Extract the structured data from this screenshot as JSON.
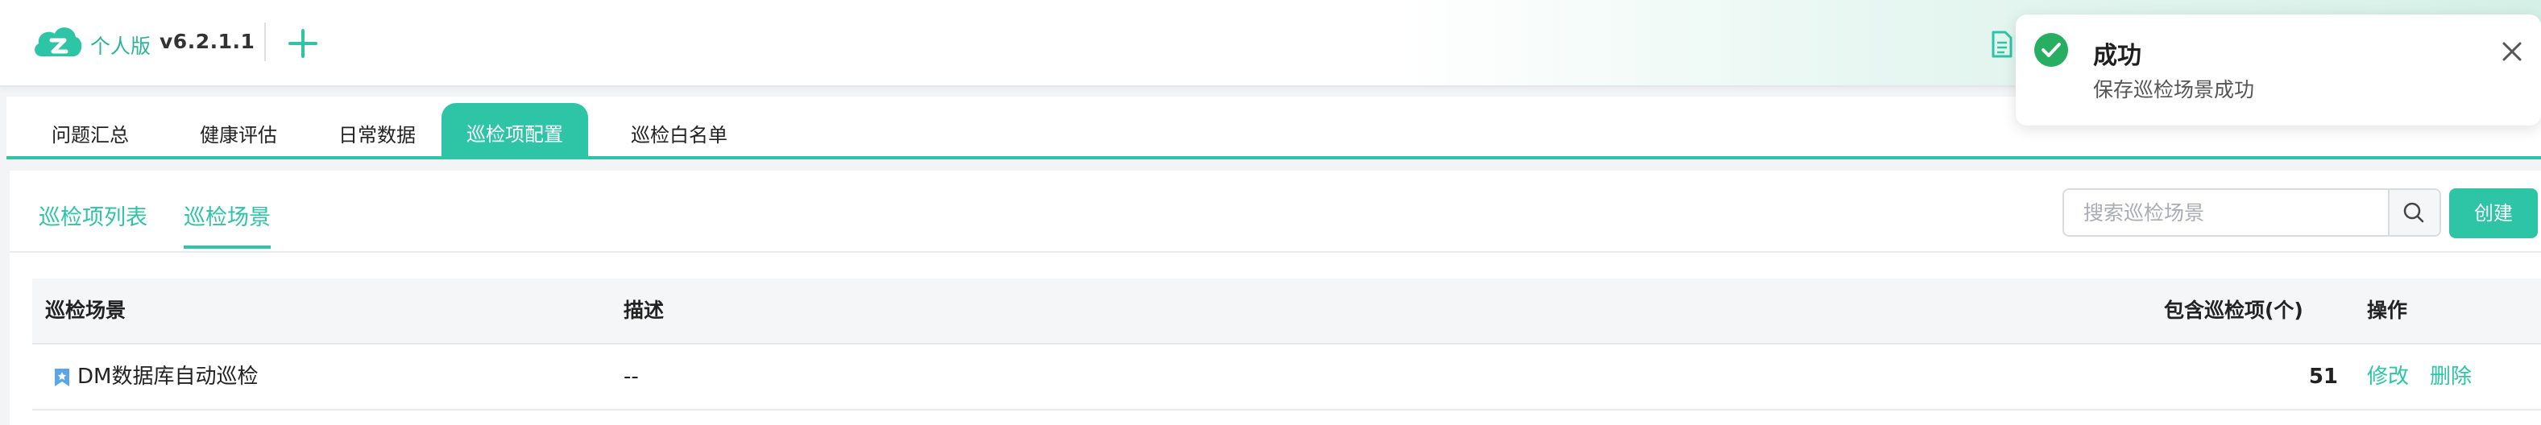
{
  "header": {
    "edition": "个人版",
    "version": "v6.2.1.1"
  },
  "tabs": [
    {
      "label": "问题汇总",
      "active": false
    },
    {
      "label": "健康评估",
      "active": false
    },
    {
      "label": "日常数据",
      "active": false
    },
    {
      "label": "巡检项配置",
      "active": true
    },
    {
      "label": "巡检白名单",
      "active": false
    }
  ],
  "subtabs": [
    {
      "label": "巡检项列表",
      "active": false
    },
    {
      "label": "巡检场景",
      "active": true
    }
  ],
  "search": {
    "placeholder": "搜索巡检场景",
    "value": ""
  },
  "create_label": "创建",
  "table": {
    "columns": [
      "巡检场景",
      "描述",
      "包含巡检项(个)",
      "操作"
    ],
    "rows": [
      {
        "name": "DM数据库自动巡检",
        "description": "--",
        "count": "51",
        "actions": [
          "修改",
          "删除"
        ]
      }
    ]
  },
  "toast": {
    "title": "成功",
    "message": "保存巡检场景成功"
  },
  "colors": {
    "accent": "#2ec4a6",
    "success": "#27ae60"
  },
  "icons": [
    "app-logo-icon",
    "plus-icon",
    "document-icon",
    "search-icon",
    "bookmark-icon",
    "check-circle-icon",
    "close-icon"
  ]
}
